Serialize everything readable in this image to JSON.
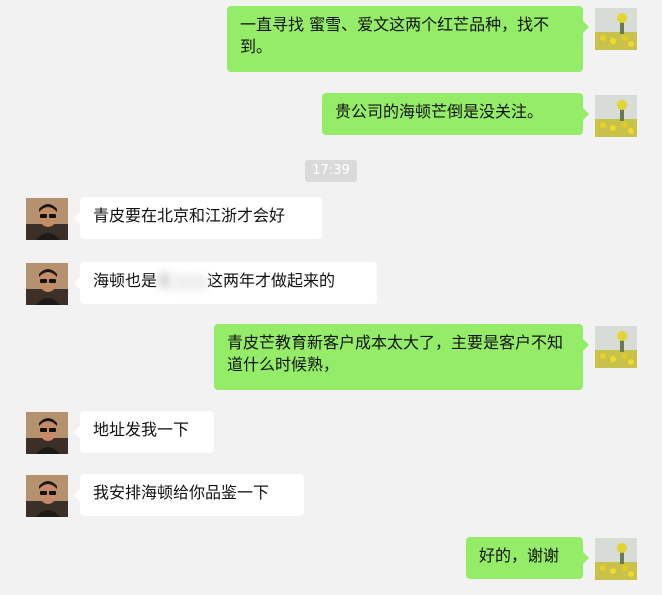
{
  "messages": [
    {
      "side": "me",
      "text": "一直寻找 蜜雪、爱文这两个红芒品种，找不到。"
    },
    {
      "side": "me",
      "text": "贵公司的海顿芒倒是没关注。"
    },
    {
      "side": "other",
      "text": "青皮要在北京和江浙才会好"
    },
    {
      "side": "other",
      "text_before": "海顿也是",
      "text_blurred": "在",
      "text_after": "这两年才做起来的"
    },
    {
      "side": "me",
      "text": "青皮芒教育新客户成本太大了，主要是客户不知道什么时候熟，"
    },
    {
      "side": "other",
      "text": "地址发我一下"
    },
    {
      "side": "other",
      "text": "我安排海顿给你品鉴一下"
    },
    {
      "side": "me",
      "text": "好的，谢谢"
    }
  ],
  "timestamp": "17:39",
  "colors": {
    "background": "#f2f2f2",
    "my_bubble": "#95ec69",
    "other_bubble": "#ffffff",
    "timestamp_bg": "#dadada"
  },
  "icons": {
    "my_avatar": "yellow-flower-field-avatar",
    "other_avatar": "man-with-sunglasses-avatar"
  }
}
